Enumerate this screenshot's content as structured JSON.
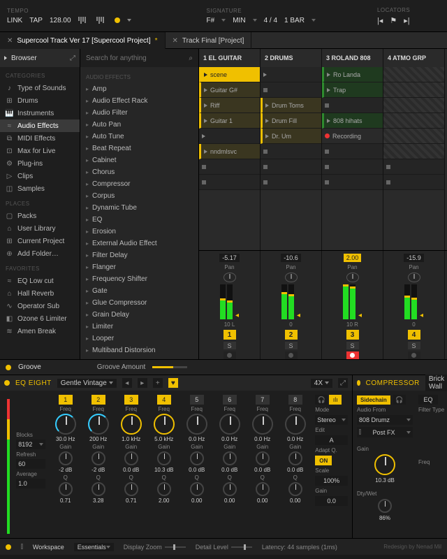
{
  "topbar": {
    "tempo_label": "TEMPO",
    "link": "LINK",
    "tap": "TAP",
    "bpm": "128.00",
    "signature_label": "SIGNATURE",
    "key": "F#",
    "keymode": "MIN",
    "timesig": "4 / 4",
    "bars": "1 BAR",
    "locators_label": "LOCATORS"
  },
  "tabs": [
    {
      "title": "Supercool Track Ver 17 [Supercool Project]",
      "mod": "*",
      "active": true
    },
    {
      "title": "Track Final [Project]",
      "mod": "",
      "active": false
    }
  ],
  "browser": {
    "title": "Browser",
    "search_ph": "Search for anything",
    "cat_label": "CATEGORIES",
    "categories": [
      "Type of Sounds",
      "Drums",
      "Instruments",
      "Audio Effects",
      "MIDI Effects",
      "Max for Live",
      "Plug-ins",
      "Clips",
      "Samples"
    ],
    "cat_sel": 3,
    "places_label": "PLACES",
    "places": [
      "Packs",
      "User Library",
      "Current Project",
      "Add Folder…"
    ],
    "fav_label": "FAVORITES",
    "favorites": [
      "EQ Low cut",
      "Hall Reverb",
      "Operator Sub",
      "Ozone 6 Limiter",
      "Amen Break"
    ],
    "fx_label": "AUDIO EFFECTS",
    "effects": [
      "Amp",
      "Audio Effect Rack",
      "Audio Filter",
      "Auto Pan",
      "Auto Tune",
      "Beat Repeat",
      "Cabinet",
      "Chorus",
      "Compressor",
      "Corpus",
      "Dynamic Tube",
      "EQ",
      "Erosion",
      "External Audio Effect",
      "Filter Delay",
      "Flanger",
      "Frequency Shifter",
      "Gate",
      "Glue Compressor",
      "Grain Delay",
      "Limiter",
      "Looper",
      "Multiband Distorsion"
    ]
  },
  "tracks": {
    "headers": [
      "1 EL GUITAR",
      "2 DRUMS",
      "3 ROLAND 808",
      "4 ATMO GRP"
    ],
    "cols": [
      [
        {
          "t": "scene",
          "c": "yel on"
        },
        {
          "t": "Guitar G#",
          "c": "yel"
        },
        {
          "t": "Riff",
          "c": "yel"
        },
        {
          "t": "Guitar 1",
          "c": "yel"
        },
        {
          "t": "",
          "c": "empty play"
        },
        {
          "t": "nndmlsvc",
          "c": "yel"
        },
        {
          "t": "",
          "c": "empty stop"
        },
        {
          "t": "",
          "c": "empty stop"
        }
      ],
      [
        {
          "t": "",
          "c": "empty play"
        },
        {
          "t": "",
          "c": "empty stop"
        },
        {
          "t": "Drum Toms",
          "c": "yel"
        },
        {
          "t": "Drum Fill",
          "c": "yel"
        },
        {
          "t": "Dr. Um",
          "c": "yel"
        },
        {
          "t": "",
          "c": "empty stop"
        },
        {
          "t": "",
          "c": "empty stop"
        },
        {
          "t": "",
          "c": "empty stop"
        }
      ],
      [
        {
          "t": "Ro Landa",
          "c": "grn"
        },
        {
          "t": "Trap",
          "c": "grn"
        },
        {
          "t": "",
          "c": "empty stop"
        },
        {
          "t": "808 hihats",
          "c": "grn"
        },
        {
          "t": "Recording",
          "c": "rec"
        },
        {
          "t": "",
          "c": "empty stop"
        },
        {
          "t": "",
          "c": "empty stop"
        },
        {
          "t": "",
          "c": "empty stop"
        }
      ],
      [
        {
          "t": "",
          "c": "gry"
        },
        {
          "t": "",
          "c": "gry"
        },
        {
          "t": "",
          "c": "gry"
        },
        {
          "t": "",
          "c": "gry"
        },
        {
          "t": "",
          "c": "gry"
        },
        {
          "t": "",
          "c": "gry"
        },
        {
          "t": "",
          "c": "empty stop"
        },
        {
          "t": "",
          "c": "empty stop"
        }
      ]
    ]
  },
  "mixer": [
    {
      "db": "-5.17",
      "pan": "Pan",
      "panv": "10 L",
      "num": "1",
      "s": "S",
      "meter": 55,
      "dbcl": ""
    },
    {
      "db": "-10.6",
      "pan": "Pan",
      "panv": "0",
      "num": "2",
      "s": "S",
      "meter": 72,
      "dbcl": ""
    },
    {
      "db": "2.00",
      "pan": "Pan",
      "panv": "10 R",
      "num": "3",
      "s": "S",
      "meter": 95,
      "dbcl": "on",
      "rec": true
    },
    {
      "db": "-15.9",
      "pan": "Pan",
      "panv": "0",
      "num": "4",
      "s": "S",
      "meter": 62,
      "dbcl": ""
    }
  ],
  "groove": {
    "title": "Groove",
    "amount_label": "Groove Amount"
  },
  "eq": {
    "name": "EQ EIGHT",
    "preset": "Gentle Vintage",
    "fourx": "4X",
    "blocks_label": "Blocks",
    "blocks": "8192",
    "refresh_label": "Refresh",
    "refresh": "60",
    "average_label": "Average",
    "average": "1.0",
    "bands": [
      {
        "n": "1",
        "on": true,
        "freq": "30.0 Hz",
        "gain": "-2 dB",
        "q": "0.71"
      },
      {
        "n": "2",
        "on": true,
        "freq": "200 Hz",
        "gain": "-2 dB",
        "q": "3.28"
      },
      {
        "n": "3",
        "on": true,
        "freq": "1.0 kHz",
        "gain": "0.0 dB",
        "q": "0.71"
      },
      {
        "n": "4",
        "on": true,
        "freq": "5.0 kHz",
        "gain": "10.3 dB",
        "q": "2.00"
      },
      {
        "n": "5",
        "on": false,
        "freq": "0.0 Hz",
        "gain": "0.0 dB",
        "q": "0.00"
      },
      {
        "n": "6",
        "on": false,
        "freq": "0.0 Hz",
        "gain": "0.0 dB",
        "q": "0.00"
      },
      {
        "n": "7",
        "on": false,
        "freq": "0.0 Hz",
        "gain": "0.0 dB",
        "q": "0.00"
      },
      {
        "n": "8",
        "on": false,
        "freq": "0.0 Hz",
        "gain": "0.0 dB",
        "q": "0.00"
      }
    ],
    "freq_lbl": "Freq",
    "gain_lbl": "Gain",
    "q_lbl": "Q",
    "mode_lbl": "Mode",
    "mode": "Stereo",
    "edit_lbl": "Edit",
    "edit": "A",
    "adapt_lbl": "Adapt Q.",
    "adapt": "ON",
    "scale_lbl": "Scale",
    "scale": "100%",
    "rgain_lbl": "Gain",
    "rgain": "0.0"
  },
  "comp": {
    "name": "COMPRESSOR",
    "preset": "Brick Wall",
    "sidechain": "Sidechain",
    "eq": "EQ",
    "audio_from_lbl": "Audio From",
    "audio_from": "808 Drumz",
    "post": "Post FX",
    "filter_lbl": "Filter Type",
    "gain_lbl": "Gain",
    "gain": "10.3 dB",
    "freq_lbl": "Freq",
    "dtywet_lbl": "Dty/Wet",
    "dtywet": "86%"
  },
  "bottom": {
    "workspace": "Workspace",
    "essentials": "Essentials",
    "zoom": "Display Zoom",
    "detail": "Detail Level",
    "latency": "Latency: 44 samples (1ms)",
    "credit": "Redesign by Nenad Mil"
  }
}
